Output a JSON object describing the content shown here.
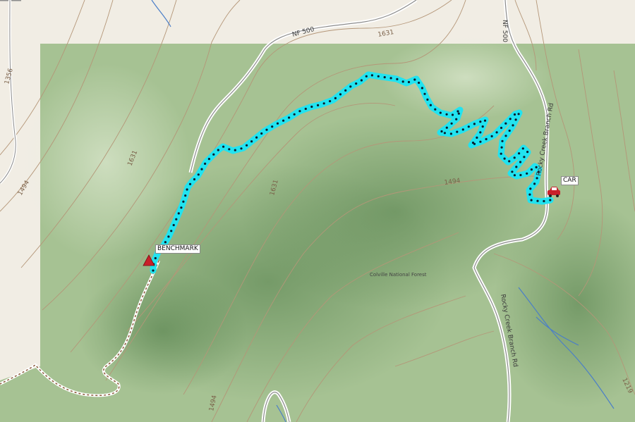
{
  "map": {
    "waypoints": {
      "car": {
        "label": "CAR",
        "icon": "car-icon",
        "color": "#c8202a"
      },
      "benchmark": {
        "label": "BENCHMARK",
        "icon": "triangle-marker-icon",
        "color": "#c8202a"
      }
    },
    "roads": {
      "nf500_a": "NF 500",
      "nf500_b": "NF 500",
      "rocky_creek_1": "Rocky Creek Branch Rd",
      "rocky_creek_2": "Rocky Creek Branch Rd"
    },
    "contours": {
      "c1631_top": "1631",
      "c1631_left": "1631",
      "c1631_mid": "1631",
      "c1494_mid": "1494",
      "c1494_left": "1494",
      "c1494_bottom": "1494",
      "c1356": "1356",
      "c1219": "1219"
    },
    "area_label": "Colville National Forest",
    "colors": {
      "forest": "#a6c293",
      "background": "#f1ede4",
      "track": "#22e3f0",
      "track_points": "#0a1a2a",
      "contour": "#b49678",
      "road": "#8c8c8c",
      "water": "#4a7ec8"
    }
  }
}
